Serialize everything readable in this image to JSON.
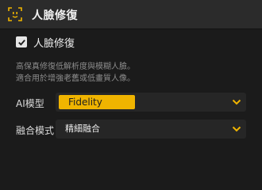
{
  "header": {
    "title": "人臉修復",
    "icon": "face-scan-icon"
  },
  "enable": {
    "label": "人臉修復",
    "checked": true
  },
  "description": {
    "line1": "高保真修復低解析度與模糊人臉。",
    "line2": "適合用於增強老舊或低畫質人像。"
  },
  "ai_model": {
    "label": "AI模型",
    "value": "Fidelity"
  },
  "blend_mode": {
    "label": "融合模式",
    "value": "精細融合"
  },
  "colors": {
    "accent": "#f0b400",
    "panel": "#1b1b1b",
    "header": "#2b2b2b"
  }
}
